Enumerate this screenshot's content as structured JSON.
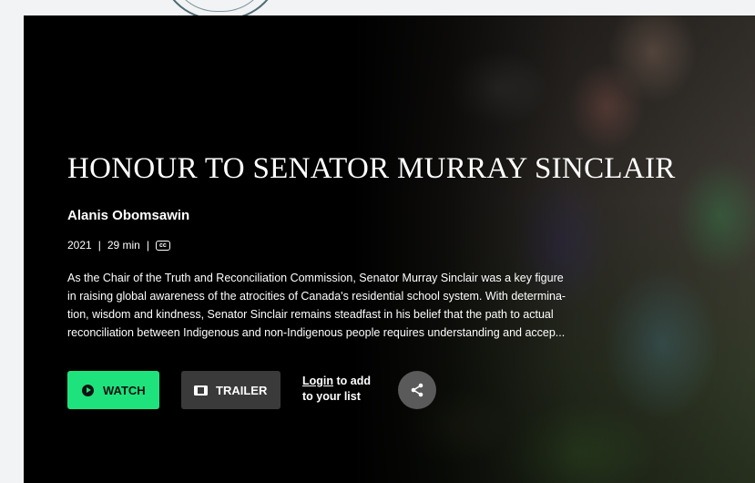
{
  "hero": {
    "title": "HONOUR TO SENATOR MURRAY SINCLAIR",
    "director": "Alanis Obomsawin",
    "year": "2021",
    "separator": "|",
    "duration": "29 min",
    "cc_label": "cc",
    "description_lines": [
      "As the Chair of the Truth and Reconciliation Commission, Senator Murray Sinclair was a key figure",
      "in raising global awareness of the atrocities of Canada's residential school system. With determina-",
      "tion, wisdom and kindness, Senator Sinclair remains steadfast in his belief that the path to actual",
      "reconciliation between Indigenous and non-Indigenous people requires understanding and accep..."
    ]
  },
  "actions": {
    "watch_label": "WATCH",
    "trailer_label": "TRAILER",
    "login_link": "Login",
    "login_suffix": " to add",
    "login_line2": "to your list"
  },
  "icons": {
    "watch": "play-circle-icon",
    "trailer": "film-icon",
    "share": "share-icon",
    "captions": "closed-captions-icon"
  },
  "colors": {
    "watch_button": "#1ee37d",
    "trailer_button": "#3a3a3a",
    "share_button": "#5a5a5a"
  }
}
